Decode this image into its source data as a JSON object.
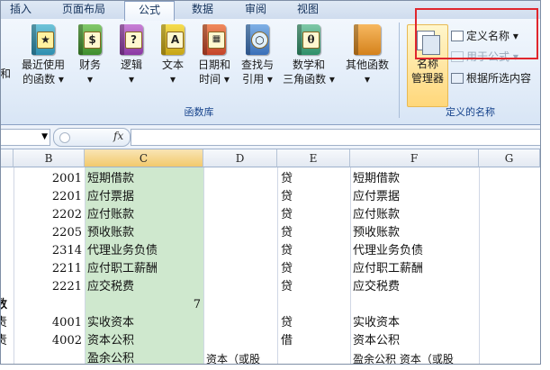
{
  "tabs": [
    {
      "label": "插入",
      "active": false
    },
    {
      "label": "页面布局",
      "active": false
    },
    {
      "label": "公式",
      "active": true
    },
    {
      "label": "数据",
      "active": false
    },
    {
      "label": "审阅",
      "active": false
    },
    {
      "label": "视图",
      "active": false
    }
  ],
  "ribbon": {
    "buttons": [
      {
        "line1": "和",
        "line2": ""
      },
      {
        "line1": "最近使用",
        "line2": "的函数 ▾"
      },
      {
        "line1": "财务",
        "line2": "▾"
      },
      {
        "line1": "逻辑",
        "line2": "▾"
      },
      {
        "line1": "文本",
        "line2": "▾"
      },
      {
        "line1": "日期和",
        "line2": "时间 ▾"
      },
      {
        "line1": "查找与",
        "line2": "引用 ▾"
      },
      {
        "line1": "数学和",
        "line2": "三角函数 ▾"
      },
      {
        "line1": "其他函数",
        "line2": "▾"
      }
    ],
    "function_library_label": "函数库",
    "name_manager_line1": "名称",
    "name_manager_line2": "管理器",
    "define_name": "定义名称 ▾",
    "use_in_formula": "用于公式 ▾",
    "create_from_selection": "根据所选内容",
    "defined_names_label": "定义的名称",
    "accent_color": "#e0262d"
  },
  "formula_bar": {
    "name_box_value": "",
    "fx_label": "fx",
    "formula_value": ""
  },
  "columns": [
    "B",
    "C",
    "D",
    "E",
    "F",
    "G"
  ],
  "selected_column": "C",
  "rows": [
    {
      "a": "",
      "b": "2001",
      "c": "短期借款",
      "d": "",
      "e": "贷",
      "f": "短期借款"
    },
    {
      "a": "",
      "b": "2201",
      "c": "应付票据",
      "d": "",
      "e": "贷",
      "f": "应付票据"
    },
    {
      "a": "",
      "b": "2202",
      "c": "应付账款",
      "d": "",
      "e": "贷",
      "f": "应付账款"
    },
    {
      "a": "",
      "b": "2205",
      "c": "预收账款",
      "d": "",
      "e": "贷",
      "f": "预收账款"
    },
    {
      "a": "",
      "b": "2314",
      "c": "代理业务负债",
      "d": "",
      "e": "贷",
      "f": "代理业务负债"
    },
    {
      "a": "",
      "b": "2211",
      "c": "应付职工薪酬",
      "d": "",
      "e": "贷",
      "f": "应付职工薪酬"
    },
    {
      "a": "",
      "b": "2221",
      "c": "应交税费",
      "d": "",
      "e": "贷",
      "f": "应交税费"
    },
    {
      "a": "数",
      "b": "",
      "c": "",
      "c_num": "7",
      "d": "",
      "e": "",
      "f": ""
    },
    {
      "a": "责",
      "b": "4001",
      "c": "实收资本",
      "d": "",
      "e": "贷",
      "f": "实收资本"
    },
    {
      "a": "责",
      "b": "4002",
      "c": "资本公积",
      "d": "",
      "e": "借",
      "f": "资本公积"
    },
    {
      "a": "",
      "b": "",
      "c": "盈余公积",
      "d": "资本（或股",
      "e": "",
      "f": "盈余公积 资本（或股"
    }
  ]
}
